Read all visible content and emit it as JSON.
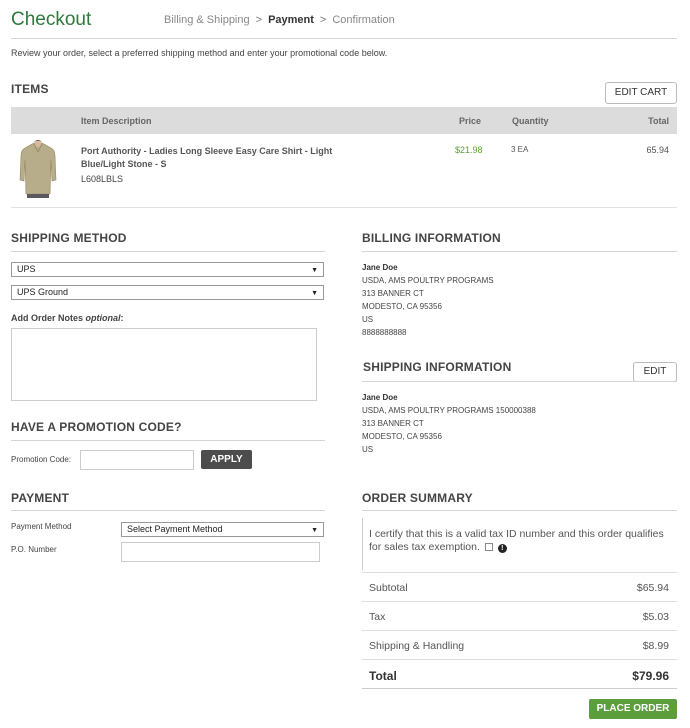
{
  "header": {
    "title": "Checkout",
    "steps": [
      "Billing & Shipping",
      "Payment",
      "Confirmation"
    ],
    "step_sep": ">"
  },
  "intro": "Review your order, select a preferred shipping method and enter your promotional code below.",
  "items": {
    "title": "ITEMS",
    "edit_cart": "EDIT CART",
    "columns": {
      "desc": "Item Description",
      "price": "Price",
      "qty": "Quantity",
      "total": "Total"
    },
    "rows": [
      {
        "name": "Port Authority - Ladies Long Sleeve Easy Care Shirt - Light Blue/Light Stone - S",
        "sku": "L608LBLS",
        "price": "$21.98",
        "qty": "3 EA",
        "total": "65.94"
      }
    ]
  },
  "shipping_method": {
    "title": "SHIPPING METHOD",
    "carrier": "UPS",
    "service": "UPS Ground",
    "notes_label": "Add Order Notes",
    "notes_optional": "optional",
    "notes_colon": ":"
  },
  "promo": {
    "title": "HAVE A PROMOTION CODE?",
    "label": "Promotion Code:",
    "apply": "APPLY"
  },
  "payment": {
    "title": "PAYMENT",
    "method_label": "Payment Method",
    "method_value": "Select Payment Method",
    "po_label": "P.O. Number"
  },
  "billing": {
    "title": "BILLING INFORMATION",
    "name": "Jane Doe",
    "org": "USDA, AMS POULTRY PROGRAMS",
    "street": "313 BANNER CT",
    "city": "MODESTO, CA 95356",
    "country": "US",
    "phone": "8888888888"
  },
  "shipping_info": {
    "title": "SHIPPING INFORMATION",
    "edit": "EDIT",
    "name": "Jane  Doe",
    "org": "USDA, AMS POULTRY PROGRAMS 150000388",
    "street": "313 BANNER CT",
    "city": "MODESTO, CA 95356",
    "country": "US"
  },
  "summary": {
    "title": "ORDER SUMMARY",
    "certify": "I certify that this is a valid tax ID number and this order qualifies for sales tax exemption.",
    "subtotal_label": "Subtotal",
    "subtotal": "$65.94",
    "tax_label": "Tax",
    "tax": "$5.03",
    "shipping_label": "Shipping & Handling",
    "shipping": "$8.99",
    "total_label": "Total",
    "total": "$79.96",
    "place_order": "PLACE ORDER"
  },
  "colors": {
    "brand_green": "#2f7a3b",
    "button_green": "#5c9e3c",
    "price_green": "#5c9e3c",
    "table_header": "#dcdcdc"
  }
}
